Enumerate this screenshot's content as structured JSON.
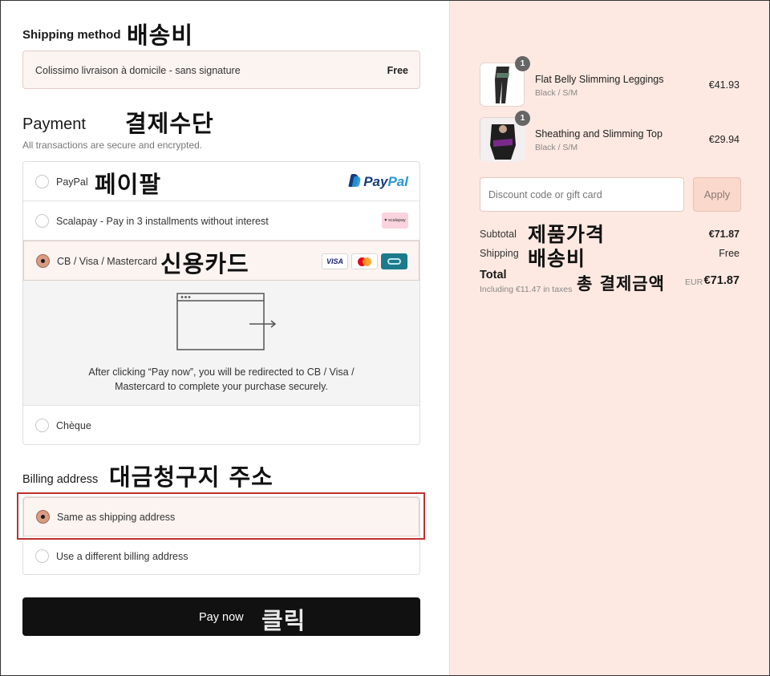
{
  "shipping": {
    "heading": "Shipping method",
    "annotation": "배송비",
    "option_label": "Colissimo livraison à domicile - sans signature",
    "option_price": "Free"
  },
  "payment": {
    "heading": "Payment",
    "annotation": "결제수단",
    "subtitle": "All transactions are secure and encrypted.",
    "options": [
      {
        "label": "PayPal",
        "annotation": "페이팔",
        "logo": "paypal-logo",
        "selected": false
      },
      {
        "label": "Scalapay - Pay in 3 installments without interest",
        "logo": "scalapay-logo",
        "logo_text": "♥ scalapay",
        "selected": false
      },
      {
        "label": "CB / Visa / Mastercard",
        "annotation": "신용카드",
        "logo": "card-icons",
        "selected": true
      },
      {
        "label": "Chèque",
        "selected": false
      }
    ],
    "paypal_logo": {
      "part1": "Pay",
      "part2": "Pal"
    },
    "visa_text": "VISA",
    "redirect_text": "After clicking “Pay now”, you will be redirected to CB / Visa / Mastercard to complete your purchase securely."
  },
  "billing": {
    "heading": "Billing address",
    "annotation": "대금청구지 주소",
    "options": [
      {
        "label": "Same as shipping address",
        "selected": true
      },
      {
        "label": "Use a different billing address",
        "selected": false
      }
    ]
  },
  "pay_button": {
    "label": "Pay now",
    "annotation": "클릭"
  },
  "summary": {
    "items": [
      {
        "name": "Flat Belly Slimming Leggings",
        "variant": "Black / S/M",
        "price": "€41.93",
        "qty": "1"
      },
      {
        "name": "Sheathing and Slimming Top",
        "variant": "Black / S/M",
        "price": "€29.94",
        "qty": "1"
      }
    ],
    "discount_placeholder": "Discount code or gift card",
    "apply_label": "Apply",
    "subtotal_label": "Subtotal",
    "subtotal_annotation": "제품가격",
    "subtotal_value": "€71.87",
    "shipping_label": "Shipping",
    "shipping_annotation": "배송비",
    "shipping_value": "Free",
    "total_label": "Total",
    "total_annotation": "총 결제금액",
    "taxes_note": "Including €11.47 in taxes",
    "currency": "EUR",
    "total_value": "€71.87"
  },
  "colors": {
    "right_panel_bg": "#fde9e2",
    "selected_row_bg": "#fbf4f1",
    "radio_selected": "#d79c83",
    "pay_button_bg": "#111111",
    "highlight_border": "#c03030"
  }
}
